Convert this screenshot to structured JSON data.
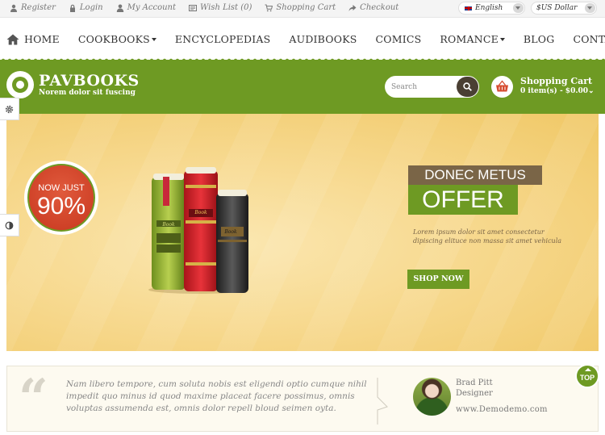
{
  "topbar": {
    "links": [
      "Register",
      "Login",
      "My Account",
      "Wish List (0)",
      "Shopping Cart",
      "Checkout"
    ],
    "language": "English",
    "currency": "$US Dollar"
  },
  "nav": {
    "items": [
      {
        "label": "HOME",
        "dropdown": false
      },
      {
        "label": "COOKBOOKS",
        "dropdown": true
      },
      {
        "label": "ENCYCLOPEDIAS",
        "dropdown": false
      },
      {
        "label": "AUDIBOOKS",
        "dropdown": false
      },
      {
        "label": "COMICS",
        "dropdown": false
      },
      {
        "label": "ROMANCE",
        "dropdown": true
      },
      {
        "label": "BLOG",
        "dropdown": false
      },
      {
        "label": "CONTACT",
        "dropdown": false
      }
    ]
  },
  "header": {
    "logo_title": "PAVBOOKS",
    "logo_subtitle": "Norem dolor sit fuscing",
    "search_placeholder": "Search",
    "cart_title": "Shopping Cart",
    "cart_summary": "0 item(s) - $0.00"
  },
  "hero": {
    "badge_line1": "NOW JUST",
    "badge_line2": "90%",
    "heading1": "DONEC METUS",
    "heading2": "OFFER",
    "description": "Lorem ipsum dolor sit amet consectetur dipiscing elituce non massa sit amet vehicula",
    "button_label": "SHOP NOW",
    "book_label": "Book"
  },
  "testimonial": {
    "quote_mark": "“",
    "text": "Nam libero tempore, cum soluta nobis est eligendi optio cumque nihil impedit quo minus id quod maxime placeat facere possimus, omnis voluptas assumenda est, omnis dolor repell bloud seimen oyta.",
    "author_name": "Brad Pitt",
    "author_role": "Designer",
    "author_site": "www.Demodemo.com"
  },
  "top_button": "TOP",
  "colors": {
    "brand_green": "#6e9a23",
    "brown": "#7a6547",
    "badge_red": "#c8371f"
  },
  "icons": {
    "topbar": [
      "user-icon",
      "lock-icon",
      "account-icon",
      "wishlist-icon",
      "cart-icon",
      "checkout-icon"
    ],
    "side_tabs": [
      "gear-icon",
      "contrast-icon"
    ]
  }
}
